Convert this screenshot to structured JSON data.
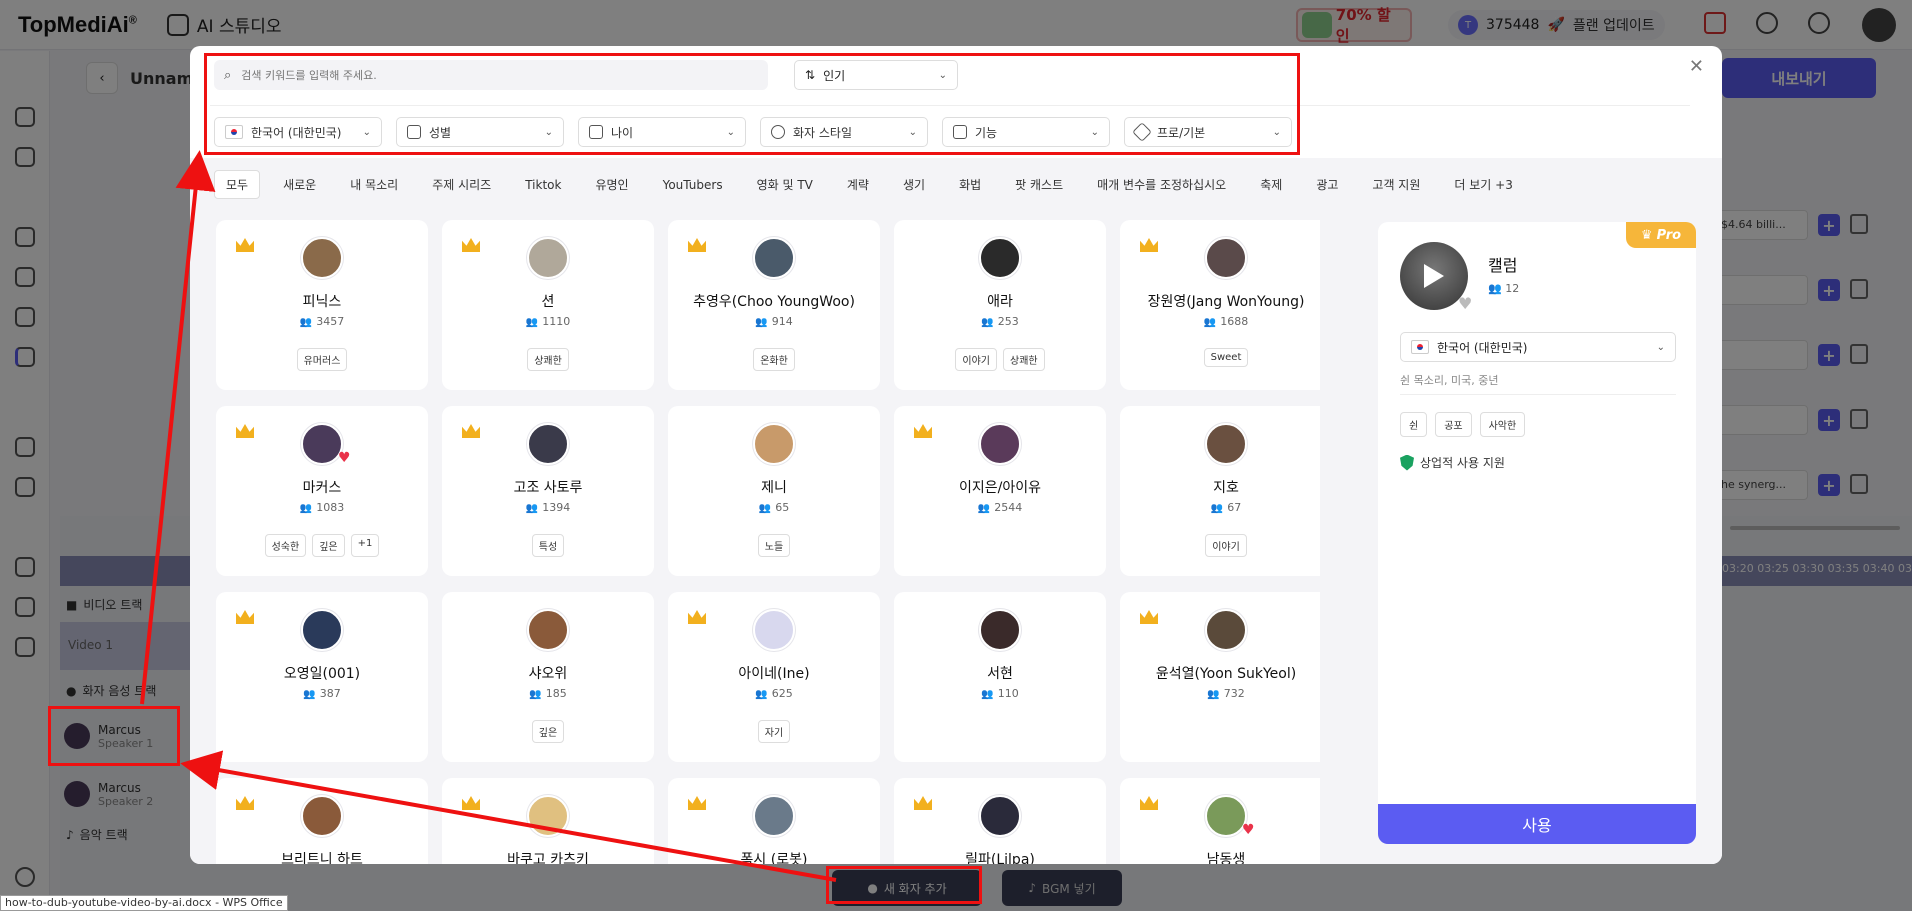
{
  "app": {
    "logo": "TopMediAi",
    "logo_mark": "®",
    "studio_label": "AI 스튜디오",
    "promo_label": "70% 할인",
    "credits": "375448",
    "upgrade_label": "플랜 업데이트"
  },
  "editor": {
    "doc_title": "Unname",
    "export_label": "내보내기",
    "rows": [
      "$4.64 billi...",
      "",
      "",
      "",
      "he synerg..."
    ],
    "timeline_times": "03:20 03:25 03:30 03:35 03:40 03:4",
    "video_track": "비디오 트랙",
    "video1": "Video 1",
    "speaker_track": "화자 음성 트랙",
    "speakers": [
      {
        "name": "Marcus",
        "role": "Speaker 1"
      },
      {
        "name": "Marcus",
        "role": "Speaker 2"
      }
    ],
    "music_track": "음악 트랙",
    "add_speaker_label": "새 화자 추가",
    "bgm_label": "BGM 넣기",
    "taskbar_tip": "how-to-dub-youtube-video-by-ai.docx - WPS Office"
  },
  "modal": {
    "search_placeholder": "검색 키워드를 입력해 주세요.",
    "sort_label": "인기",
    "filters": [
      "한국어 (대한민국)",
      "성별",
      "나이",
      "화자 스타일",
      "기능",
      "프로/기본"
    ],
    "categories": [
      "모두",
      "새로운",
      "내 목소리",
      "주제 시리즈",
      "Tiktok",
      "유명인",
      "YouTubers",
      "영화 및 TV",
      "계략",
      "생기",
      "화법",
      "팟 캐스트",
      "매개 변수를 조정하십시오",
      "축제",
      "광고",
      "고객 지원",
      "더 보기 +3"
    ],
    "voices": [
      {
        "name": "피닉스",
        "count": "3457",
        "tags": [
          "유머러스"
        ],
        "color": "#8a6a4a"
      },
      {
        "name": "션",
        "count": "1110",
        "tags": [
          "상쾌한"
        ],
        "color": "#b0a89a"
      },
      {
        "name": "추영우(Choo YoungWoo)",
        "count": "914",
        "tags": [
          "온화한"
        ],
        "color": "#4a5a6a"
      },
      {
        "name": "애라",
        "count": "253",
        "tags": [
          "이야기",
          "상쾌한"
        ],
        "color": "#2a2a2a"
      },
      {
        "name": "장원영(Jang WonYoung)",
        "count": "1688",
        "tags": [
          "Sweet"
        ],
        "color": "#5a4a4a"
      },
      {
        "name": "마커스",
        "count": "1083",
        "tags": [
          "성숙한",
          "깊은",
          "+1"
        ],
        "color": "#4a3a5a"
      },
      {
        "name": "고조 사토루",
        "count": "1394",
        "tags": [
          "특성"
        ],
        "color": "#3a3a4a"
      },
      {
        "name": "제니",
        "count": "65",
        "tags": [
          "노들"
        ],
        "color": "#c89a6a"
      },
      {
        "name": "이지은/아이유",
        "count": "2544",
        "tags": [],
        "color": "#5a3a5a"
      },
      {
        "name": "지호",
        "count": "67",
        "tags": [
          "이야기"
        ],
        "color": "#6a5040"
      },
      {
        "name": "오영일(001)",
        "count": "387",
        "tags": [],
        "color": "#2a3a5a"
      },
      {
        "name": "샤오위",
        "count": "185",
        "tags": [
          "깊은"
        ],
        "color": "#8a5a3a"
      },
      {
        "name": "아이네(Ine)",
        "count": "625",
        "tags": [
          "자기"
        ],
        "color": "#d8d8ee"
      },
      {
        "name": "서현",
        "count": "110",
        "tags": [],
        "color": "#3a2a2a"
      },
      {
        "name": "윤석열(Yoon SukYeol)",
        "count": "732",
        "tags": [],
        "color": "#5a4a3a"
      },
      {
        "name": "브리트니 하트",
        "count": "",
        "tags": [],
        "color": "#8a5a3a"
      },
      {
        "name": "바쿠고 카츠키",
        "count": "",
        "tags": [],
        "color": "#e0c080"
      },
      {
        "name": "폭시 (로봇)",
        "count": "",
        "tags": [],
        "color": "#6a7a8a"
      },
      {
        "name": "릴파(Lilpa)",
        "count": "",
        "tags": [],
        "color": "#2a2a3a"
      },
      {
        "name": "남동생",
        "count": "",
        "tags": [],
        "color": "#7a9a5a"
      }
    ],
    "selected": {
      "pro_label": "Pro",
      "name": "캘럼",
      "count": "12",
      "language": "한국어 (대한민국)",
      "desc": "쉰 목소리, 미국, 중년",
      "tags": [
        "쉰",
        "공포",
        "사악한"
      ],
      "commercial": "상업적 사용 지원",
      "use_label": "사용"
    }
  }
}
